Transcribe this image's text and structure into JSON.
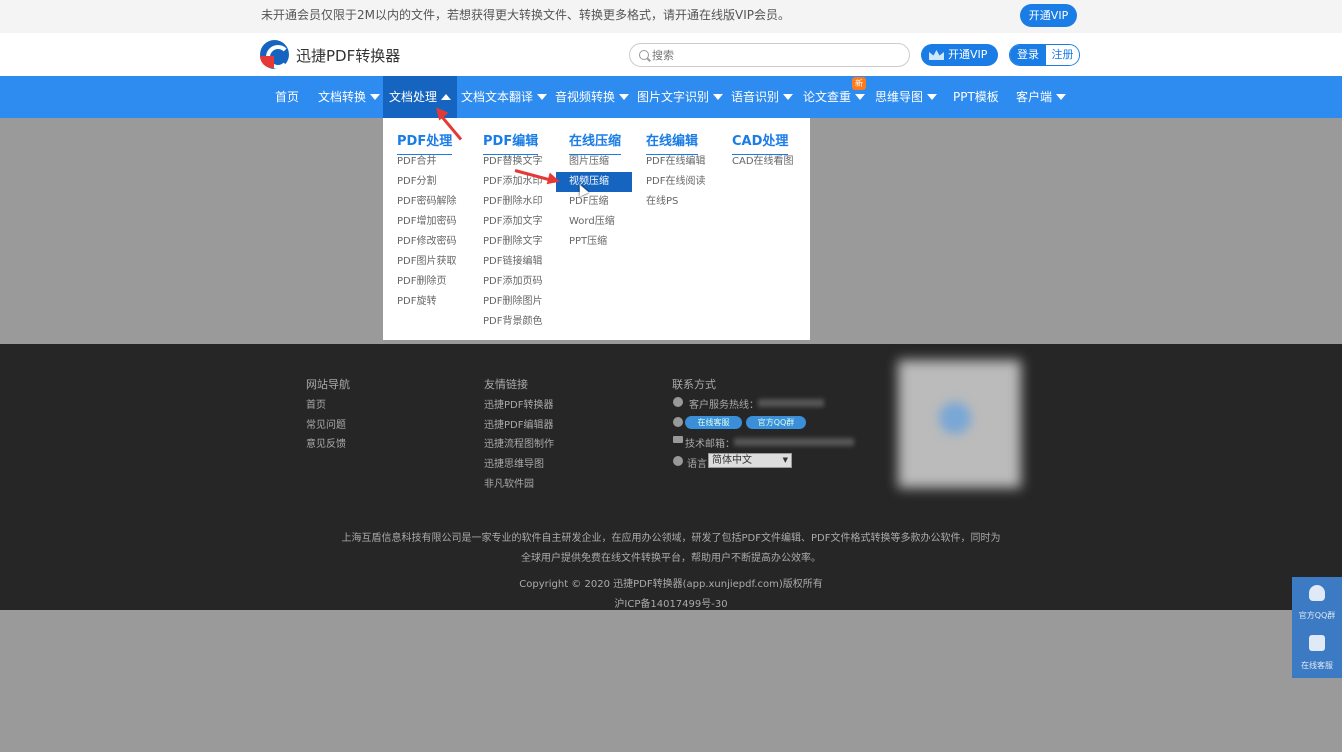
{
  "notice": {
    "text": "未开通会员仅限于2M以内的文件，若想获得更大转换文件、转换更多格式，请开通在线版VIP会员。",
    "vip_button": "开通VIP"
  },
  "header": {
    "logo_text": "迅捷PDF转换器",
    "search_placeholder": "搜索",
    "vip_button": "开通VIP",
    "login": "登录",
    "register": "注册"
  },
  "nav": {
    "items": [
      "首页",
      "文档转换",
      "文档处理",
      "文档文本翻译",
      "音视频转换",
      "图片文字识别",
      "语音识别",
      "论文查重",
      "思维导图",
      "PPT模板",
      "客户端"
    ],
    "active": "文档处理",
    "new_badge": "新"
  },
  "dropdown": {
    "columns": [
      {
        "title": "PDF处理",
        "items": [
          "PDF合并",
          "PDF分割",
          "PDF密码解除",
          "PDF增加密码",
          "PDF修改密码",
          "PDF图片获取",
          "PDF删除页",
          "PDF旋转"
        ]
      },
      {
        "title": "PDF编辑",
        "items": [
          "PDF替换文字",
          "PDF添加水印",
          "PDF删除水印",
          "PDF添加文字",
          "PDF删除文字",
          "PDF链接编辑",
          "PDF添加页码",
          "PDF删除图片",
          "PDF背景颜色"
        ]
      },
      {
        "title": "在线压缩",
        "items": [
          "图片压缩",
          "视频压缩",
          "PDF压缩",
          "Word压缩",
          "PPT压缩"
        ],
        "highlighted": "视频压缩"
      },
      {
        "title": "在线编辑",
        "items": [
          "PDF在线编辑",
          "PDF在线阅读",
          "在线PS"
        ]
      },
      {
        "title": "CAD处理",
        "items": [
          "CAD在线看图"
        ]
      }
    ]
  },
  "footer": {
    "nav_title": "网站导航",
    "nav_links": [
      "首页",
      "常见问题",
      "意见反馈"
    ],
    "friends_title": "友情链接",
    "friends_links": [
      "迅捷PDF转换器",
      "迅捷PDF编辑器",
      "迅捷流程图制作",
      "迅捷思维导图",
      "非凡软件园"
    ],
    "contact_title": "联系方式",
    "hotline_label": "客户服务热线：",
    "online_service": "在线客服",
    "qq_group": "官方QQ群",
    "email_label": "技术邮箱：",
    "language_label": "语言",
    "language_value": "简体中文",
    "description_line1": "上海互盾信息科技有限公司是一家专业的软件自主研发企业，在应用办公领域，研发了包括PDF文件编辑、PDF文件格式转换等多款办公软件，同时为",
    "description_line2": "全球用户提供免费在线文件转换平台，帮助用户不断提高办公效率。",
    "copyright": "Copyright © 2020 迅捷PDF转换器(app.xunjiepdf.com)版权所有",
    "icp": "沪ICP备14017499号-30"
  },
  "side_float": {
    "qq_group": "官方QQ群",
    "online_service": "在线客服"
  }
}
